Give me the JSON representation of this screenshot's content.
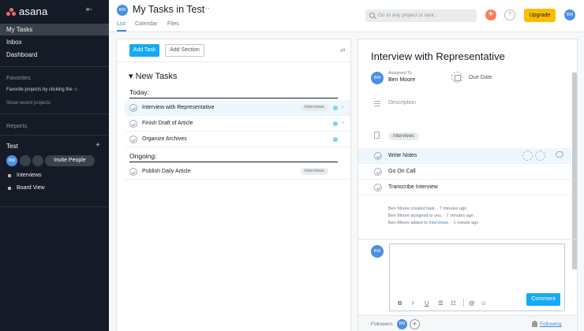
{
  "app": {
    "logo_text": "asana"
  },
  "sidebar": {
    "nav": [
      {
        "label": "My Tasks",
        "active": true
      },
      {
        "label": "Inbox",
        "active": false
      },
      {
        "label": "Dashboard",
        "active": false
      }
    ],
    "favorites": {
      "heading": "Favorites",
      "hint": "Favorite projects by clicking the ☆",
      "show_recent": "Show recent projects"
    },
    "reports": {
      "heading": "Reports"
    },
    "team": {
      "name": "Test",
      "add_icon": "+",
      "member_initials": "BM",
      "invite_label": "Invite People",
      "projects": [
        {
          "label": "Interviews"
        },
        {
          "label": "Board View"
        }
      ]
    }
  },
  "header": {
    "avatar_initials": "BM",
    "title": "My Tasks in Test",
    "more": "···",
    "tabs": [
      {
        "label": "List",
        "active": true
      },
      {
        "label": "Calendar"
      },
      {
        "label": "Files"
      }
    ],
    "search_placeholder": "Go to any project or task...",
    "plus": "+",
    "help": "?",
    "upgrade_label": "Upgrade",
    "user_initials": "BM"
  },
  "list": {
    "add_task_label": "Add Task",
    "add_section_label": "Add Section",
    "section_title": "New Tasks",
    "groups": [
      {
        "label": "Today:",
        "tasks": [
          {
            "name": "Interview with Representative",
            "tag": "Interviews",
            "dot": true,
            "selected": true
          },
          {
            "name": "Finish Draft of Article",
            "tag": "",
            "dot": true
          },
          {
            "name": "Organize Archives",
            "tag": "",
            "dot": true
          }
        ]
      },
      {
        "label": "Ongoing:",
        "tasks": [
          {
            "name": "Publish Daily Article",
            "tag": "Interviews",
            "dot": false
          }
        ]
      }
    ]
  },
  "detail": {
    "title": "Interview with Representative",
    "assignee_initials": "BM",
    "assigned_to_label": "Assigned To",
    "assignee_name": "Ben Moore",
    "due_date_label": "Due Date",
    "description_placeholder": "Description",
    "tag": "Interviews",
    "subtasks": [
      {
        "name": "Write Notes",
        "selected": true
      },
      {
        "name": "Go On Call"
      },
      {
        "name": "Transcribe Interview"
      }
    ],
    "activity": [
      {
        "text": "Ben Moore created task.  ·  7 minutes ago"
      },
      {
        "text": "Ben Moore assigned to you.  ·  7 minutes ago"
      },
      {
        "prefix": "Ben Moore added to ",
        "link": "Interviews",
        "suffix": ".  ·  1 minute ago"
      }
    ],
    "comment_avatar": "BM",
    "toolbar": {
      "bold": "B",
      "italic": "I",
      "underline": "U",
      "bullets": "☰",
      "numbers": "☷",
      "mention": "@",
      "emoji": "☺"
    },
    "comment_label": "Comment",
    "followers_label": "Followers",
    "follower_initials": "BM",
    "add_follower": "+",
    "following_label": "Following"
  },
  "colors": {
    "sidebar_bg": "#151b26",
    "accent": "#14aaf5",
    "upgrade": "#fcbd01",
    "avatar": "#4a90e2"
  }
}
